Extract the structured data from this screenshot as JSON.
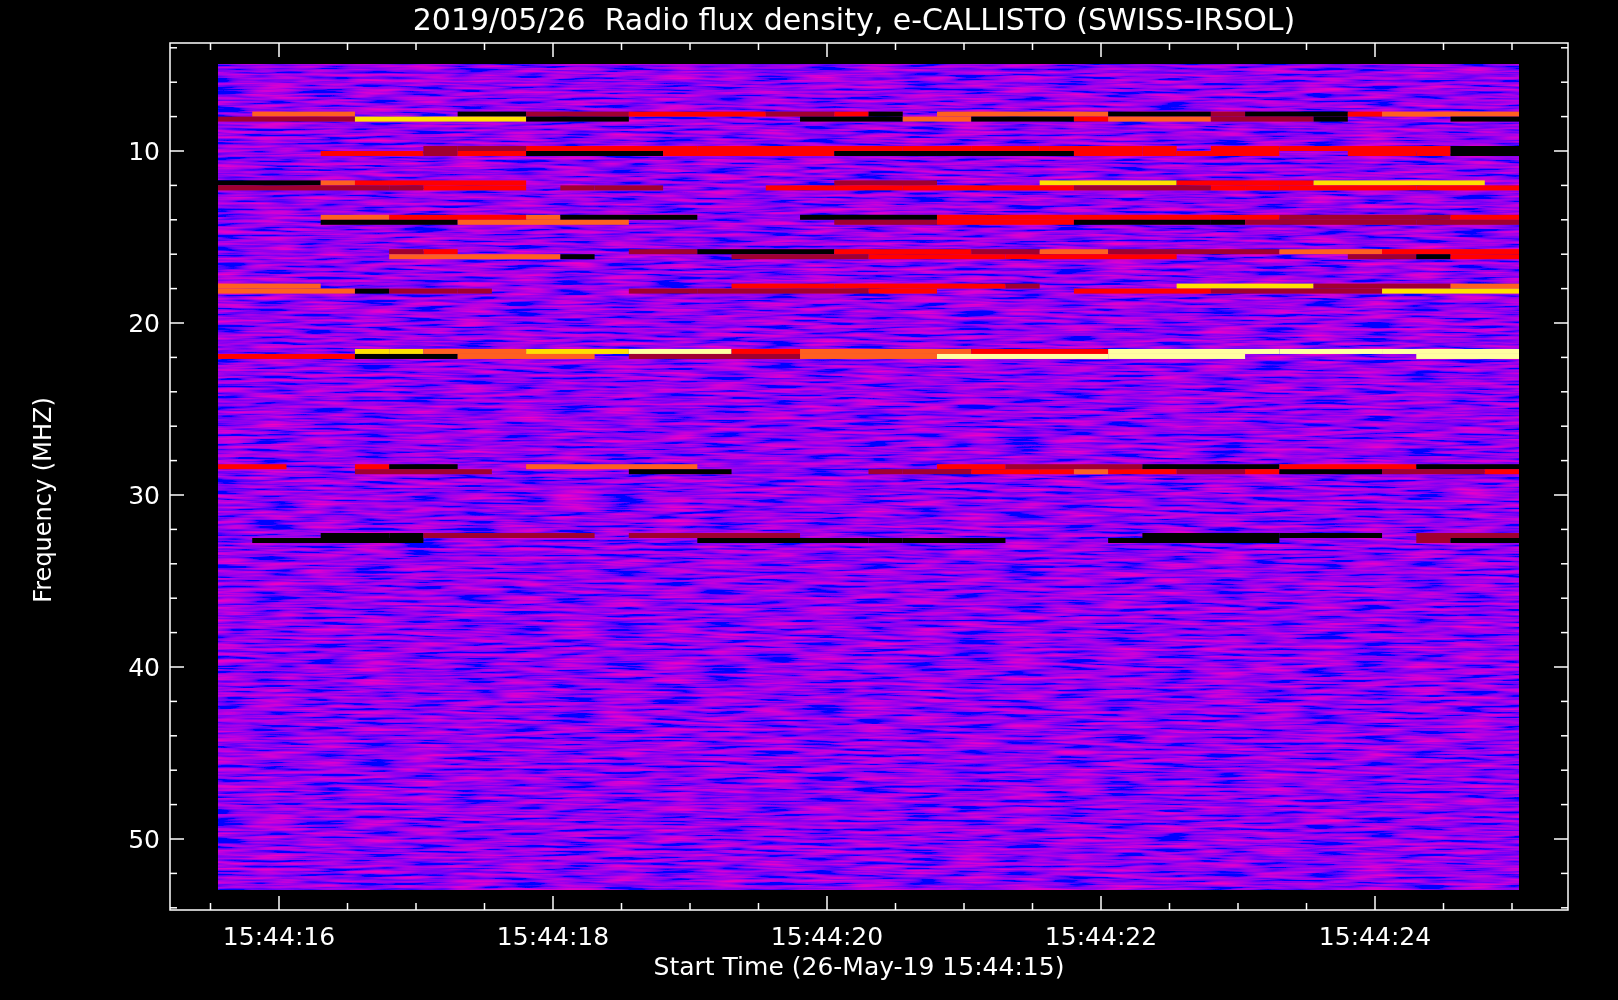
{
  "title": "2019/05/26  Radio flux density, e-CALLISTO (SWISS-IRSOL)",
  "y_axis": {
    "label": "Frequency (MHZ)",
    "ticks": [
      "10",
      "20",
      "30",
      "40",
      "50"
    ]
  },
  "x_axis": {
    "label": "Start Time (26-May-19 15:44:15)",
    "ticks": [
      "15:44:16",
      "15:44:18",
      "15:44:20",
      "15:44:22",
      "15:44:24"
    ]
  }
}
